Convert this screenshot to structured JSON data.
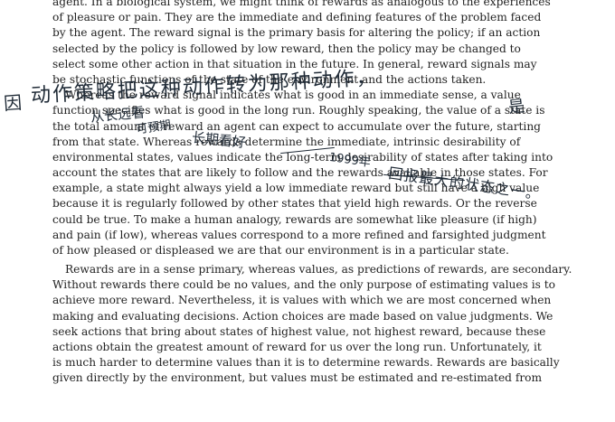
{
  "paragraph1": {
    "lines": [
      "agent. In a biological system, we might think of rewards as analogous to the experiences",
      "of pleasure or pain. They are the immediate and defining features of the problem faced",
      "by the agent. The reward signal is the primary basis for altering the policy; if an action",
      "selected by the policy is followed by low reward, then the policy may be changed to",
      "select some other action in that situation in the future. In general, reward signals may",
      "be stochastic functions of the state of the environment and the actions taken.",
      "Whereas the reward signal indicates what is good in an immediate sense, a value",
      "function specifies what is good in the long run. Roughly speaking, the value of a state is",
      "the total amount of reward an agent can expect to accumulate over the future, starting",
      "from that state. Whereas rewards determine the immediate, intrinsic desirability of",
      "environmental states, values indicate the long-term desirability of states after taking into",
      "account the states that are likely to follow and the rewards available in those states. For",
      "example, a state might always yield a low immediate reward but still have a high value",
      "because it is regularly followed by other states that yield high rewards. Or the reverse",
      "could be true. To make a human analogy, rewards are somewhat like pleasure (if high)",
      "and pain (if low), whereas values correspond to a more refined and farsighted judgment",
      "of how pleased or displeased we are that our environment is in a particular state."
    ]
  },
  "paragraph2": {
    "lines": [
      "Rewards are in a sense primary, whereas values, as predictions of rewards, are secondary.",
      "Without rewards there could be no values, and the only purpose of estimating values is to",
      "achieve more reward. Nevertheless, it is values with which we are most concerned when",
      "making and evaluating decisions. Action choices are made based on value judgments. We",
      "seek actions that bring about states of highest value, not highest reward, because these",
      "actions obtain the greatest amount of reward for us over the long run. Unfortunately, it",
      "is much harder to determine values than it is to determine rewards. Rewards are basically",
      "given directly by the environment, but values must be estimated and re-estimated from"
    ]
  },
  "annotations": {
    "a1": "因",
    "a2": "动作策略把这种动作转为那种动作，",
    "a3": "是",
    "a4": "从长远看",
    "a5": "长期看好",
    "a6": "可预期",
    "a7": "1999年",
    "a8": "回报最大的状态之一。"
  }
}
